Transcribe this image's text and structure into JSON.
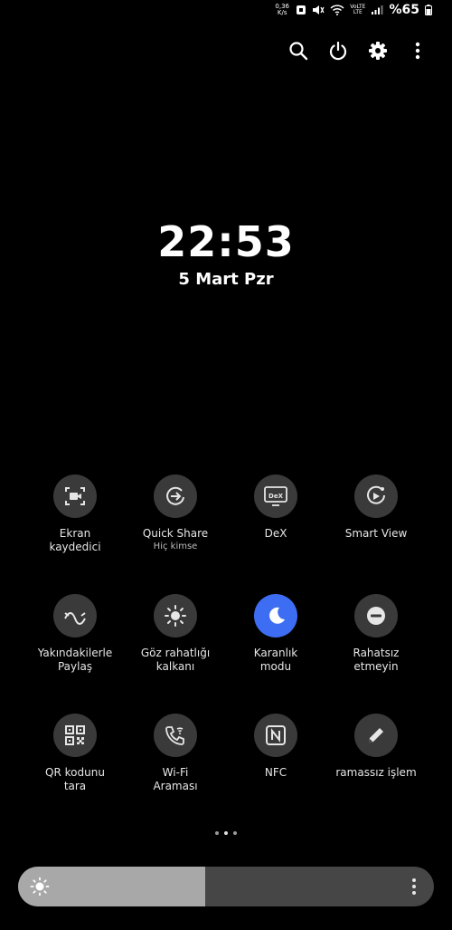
{
  "status_bar": {
    "speed_value": "0,36",
    "speed_unit": "K/s",
    "volte_label": "VoLTE",
    "lte_label": "LTE",
    "battery_percent": "%65"
  },
  "lockscreen": {
    "time": "22:53",
    "date": "5 Mart Pzr"
  },
  "top_actions": [
    {
      "icon": "search-icon"
    },
    {
      "icon": "power-icon"
    },
    {
      "icon": "gear-icon"
    },
    {
      "icon": "more-vertical-icon"
    }
  ],
  "tiles": [
    {
      "label": "Ekran\nkaydedici",
      "sub": "",
      "icon": "screen-recorder-icon",
      "active": false
    },
    {
      "label": "Quick Share",
      "sub": "Hiç kimse",
      "icon": "quick-share-icon",
      "active": false
    },
    {
      "label": "DeX",
      "sub": "",
      "icon": "dex-icon",
      "icon_text": "DeX",
      "active": false
    },
    {
      "label": "Smart View",
      "sub": "",
      "icon": "smart-view-icon",
      "active": false
    },
    {
      "label": "Yakındakilerle\nPaylaş",
      "sub": "",
      "icon": "nearby-share-icon",
      "active": false
    },
    {
      "label": "Göz rahatlığı\nkalkanı",
      "sub": "",
      "icon": "eye-comfort-icon",
      "active": false
    },
    {
      "label": "Karanlık\nmodu",
      "sub": "",
      "icon": "moon-icon",
      "active": true
    },
    {
      "label": "Rahatsız\netmeyin",
      "sub": "",
      "icon": "do-not-disturb-icon",
      "active": false
    },
    {
      "label": "QR kodunu\ntara",
      "sub": "",
      "icon": "qr-code-icon",
      "active": false
    },
    {
      "label": "Wi-Fi\nAraması",
      "sub": "",
      "icon": "wifi-calling-icon",
      "active": false
    },
    {
      "label": "NFC",
      "sub": "",
      "icon": "nfc-icon",
      "active": false
    },
    {
      "label": "ramassız işlem",
      "sub": "",
      "icon": "pencil-icon",
      "active": false
    }
  ],
  "pager": {
    "count": 3,
    "current": 2
  },
  "brightness": {
    "level_fraction": 0.45
  }
}
